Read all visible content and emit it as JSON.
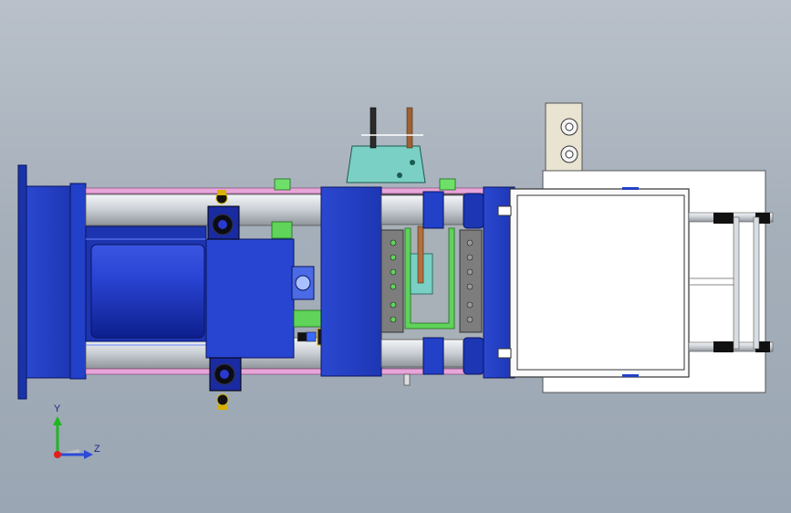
{
  "triad": {
    "y_label": "Y",
    "z_label": "Z"
  },
  "colors": {
    "background_top": "#b9c0c9",
    "background_bottom": "#9aa6b3",
    "machine_blue": "#2440c8",
    "rod_silver": "#d8dde2",
    "pink_band": "#e8a5d8",
    "green_part": "#5fd35a",
    "teal_part": "#7ad0c4",
    "mold_gray": "#8a8a8a",
    "white_part": "#ffffff",
    "beige_plate": "#e9e3d2"
  }
}
